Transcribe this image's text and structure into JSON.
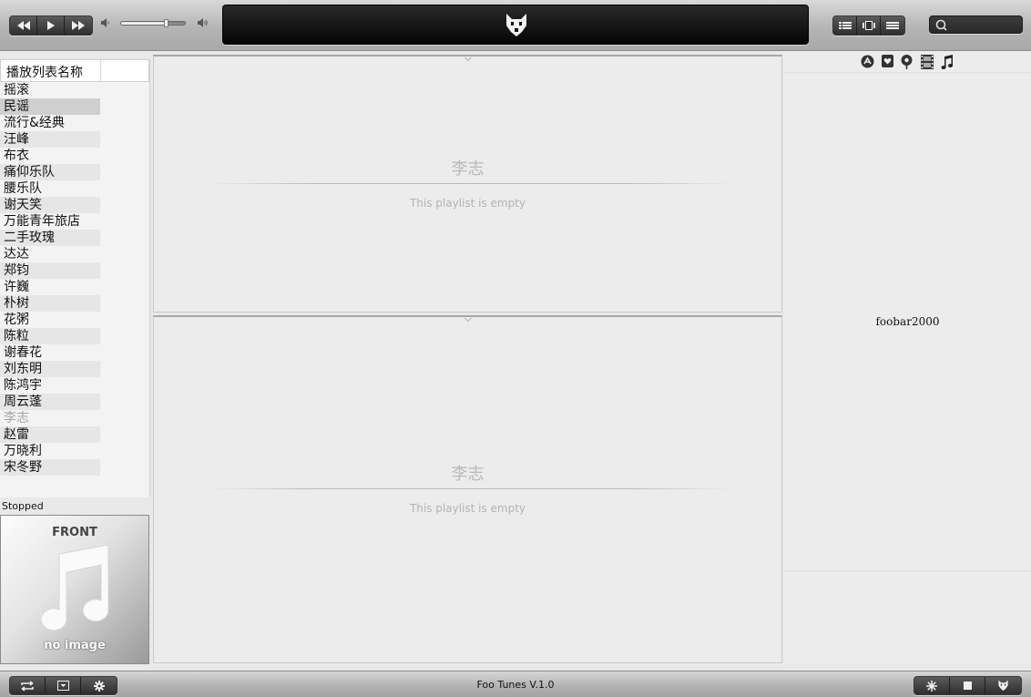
{
  "window": {
    "app_title": "Foo Tunes V.1.0"
  },
  "search": {
    "placeholder": ""
  },
  "volume": {
    "level": 0.72
  },
  "playlist_manager": {
    "header": "播放列表名称",
    "items": [
      {
        "label": "摇滚",
        "state": "normal"
      },
      {
        "label": "民谣",
        "state": "selected"
      },
      {
        "label": "流行&经典",
        "state": "normal"
      },
      {
        "label": "汪峰",
        "state": "normal"
      },
      {
        "label": "布衣",
        "state": "normal"
      },
      {
        "label": "痛仰乐队",
        "state": "normal"
      },
      {
        "label": "腰乐队",
        "state": "normal"
      },
      {
        "label": "谢天笑",
        "state": "normal"
      },
      {
        "label": "万能青年旅店",
        "state": "normal"
      },
      {
        "label": "二手玫瑰",
        "state": "normal"
      },
      {
        "label": "达达",
        "state": "normal"
      },
      {
        "label": "郑钧",
        "state": "normal"
      },
      {
        "label": "许巍",
        "state": "normal"
      },
      {
        "label": "朴树",
        "state": "normal"
      },
      {
        "label": "花粥",
        "state": "normal"
      },
      {
        "label": "陈粒",
        "state": "normal"
      },
      {
        "label": "谢春花",
        "state": "normal"
      },
      {
        "label": "刘东明",
        "state": "normal"
      },
      {
        "label": "陈鸿宇",
        "state": "normal"
      },
      {
        "label": "周云蓬",
        "state": "normal"
      },
      {
        "label": "李志",
        "state": "playing"
      },
      {
        "label": "赵雷",
        "state": "normal"
      },
      {
        "label": "万晓利",
        "state": "normal"
      },
      {
        "label": "宋冬野",
        "state": "normal"
      }
    ]
  },
  "status": {
    "text": "Stopped"
  },
  "cover": {
    "title": "FRONT",
    "subtitle": "no image"
  },
  "pane_top": {
    "playlist_name": "李志",
    "empty_text": "This playlist is empty"
  },
  "pane_bottom": {
    "playlist_name": "李志",
    "empty_text": "This playlist is empty"
  },
  "right_panel": {
    "label": "foobar2000"
  },
  "icons": {
    "transport": [
      "previous-icon",
      "play-icon",
      "next-icon"
    ],
    "views": [
      "list-view-icon",
      "album-view-icon",
      "compact-view-icon"
    ],
    "right_toolbar": [
      "lastfm-icon",
      "heart-icon",
      "podcast-icon",
      "film-icon",
      "music-note-icon"
    ],
    "bottom_left": [
      "repeat-icon",
      "dropdown-icon",
      "settings-icon"
    ],
    "bottom_right": [
      "star-icon",
      "stop-icon",
      "fox-logo-icon"
    ]
  }
}
